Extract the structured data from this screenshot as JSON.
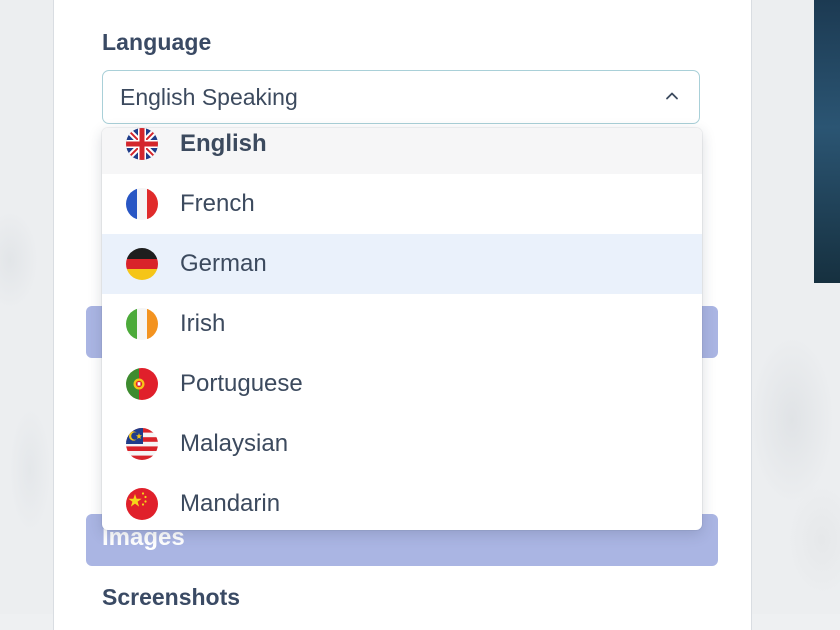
{
  "form": {
    "language_label": "Language",
    "language_select": {
      "value": "English Speaking",
      "options": [
        {
          "label": "English",
          "flag": "uk-flag-icon",
          "state": "selected"
        },
        {
          "label": "French",
          "flag": "france-flag-icon",
          "state": ""
        },
        {
          "label": "German",
          "flag": "germany-flag-icon",
          "state": "highlighted"
        },
        {
          "label": "Irish",
          "flag": "ireland-flag-icon",
          "state": ""
        },
        {
          "label": "Portuguese",
          "flag": "portugal-flag-icon",
          "state": ""
        },
        {
          "label": "Malaysian",
          "flag": "malaysia-flag-icon",
          "state": ""
        },
        {
          "label": "Mandarin",
          "flag": "china-flag-icon",
          "state": ""
        }
      ]
    },
    "images_section_title": "Images",
    "screenshots_label": "Screenshots"
  },
  "colors": {
    "section_bar": "#aab5e3",
    "select_border": "#a9d0d8",
    "highlight_row": "#eaf1fb",
    "text": "#3c4a5e"
  }
}
